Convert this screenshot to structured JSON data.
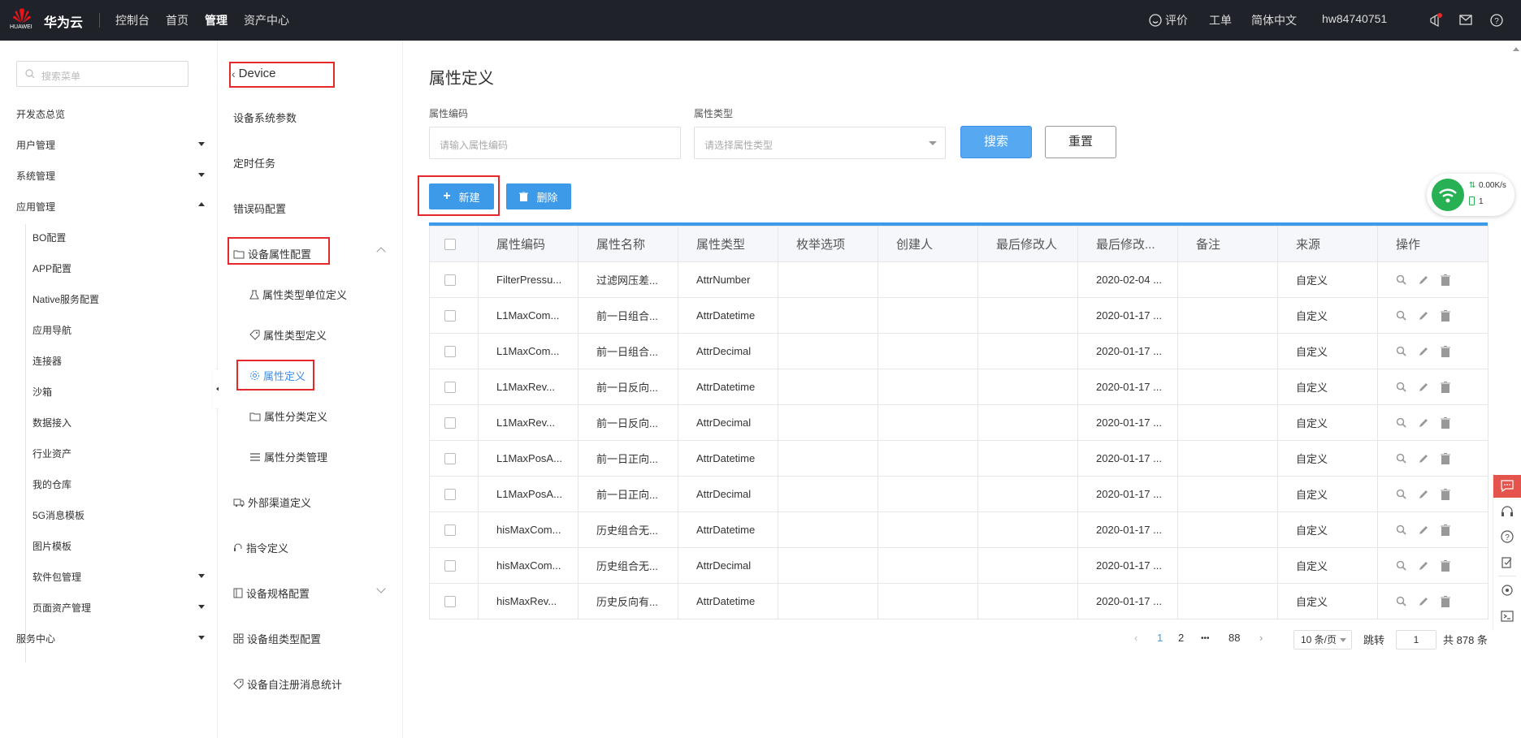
{
  "topbar": {
    "logo_text": "HUAWEI",
    "brand": "华为云",
    "nav": [
      "控制台",
      "首页",
      "管理",
      "资产中心"
    ],
    "active_nav": "管理",
    "right": {
      "feedback": "评价",
      "ticket": "工单",
      "language": "简体中文",
      "username": "hw84740751"
    }
  },
  "sidebar": {
    "search_placeholder": "搜索菜单",
    "items": [
      {
        "label": "开发态总览"
      },
      {
        "label": "用户管理",
        "arrow": "down"
      },
      {
        "label": "系统管理",
        "arrow": "down"
      },
      {
        "label": "应用管理",
        "arrow": "up"
      }
    ],
    "sub_items": [
      "BO配置",
      "APP配置",
      "Native服务配置",
      "应用导航",
      "连接器",
      "沙箱",
      "数据接入",
      "行业资产",
      "我的仓库",
      "5G消息模板",
      "图片模板",
      "软件包管理",
      "页面资产管理"
    ],
    "bottom_items": [
      {
        "label": "服务中心",
        "arrow": "down"
      }
    ]
  },
  "menu2": {
    "back_label": "Device",
    "items": {
      "sys_params": "设备系统参数",
      "timer": "定时任务",
      "error_code": "错误码配置",
      "attr_config": "设备属性配置",
      "attr_unit": "属性类型单位定义",
      "attr_type": "属性类型定义",
      "attr_def": "属性定义",
      "attr_cat_def": "属性分类定义",
      "attr_cat_mgmt": "属性分类管理",
      "ext_channel": "外部渠道定义",
      "cmd_def": "指令定义",
      "spec_config": "设备规格配置",
      "group_type": "设备组类型配置",
      "self_reg": "设备自注册消息统计"
    }
  },
  "main": {
    "title": "属性定义",
    "filters": {
      "code_label": "属性编码",
      "code_placeholder": "请输入属性编码",
      "type_label": "属性类型",
      "type_placeholder": "请选择属性类型"
    },
    "buttons": {
      "search": "搜索",
      "reset": "重置",
      "new": "新建",
      "delete": "删除"
    },
    "table": {
      "columns": [
        "属性编码",
        "属性名称",
        "属性类型",
        "枚举选项",
        "创建人",
        "最后修改人",
        "最后修改...",
        "备注",
        "来源",
        "操作"
      ],
      "rows": [
        {
          "code": "FilterPressu...",
          "name": "过滤网压差...",
          "type": "AttrNumber",
          "enum": "",
          "creator": "",
          "modifier": "",
          "modified": "2020-02-04 ...",
          "remark": "",
          "source": "自定义"
        },
        {
          "code": "L1MaxCom...",
          "name": "前一日组合...",
          "type": "AttrDatetime",
          "enum": "",
          "creator": "",
          "modifier": "",
          "modified": "2020-01-17 ...",
          "remark": "",
          "source": "自定义"
        },
        {
          "code": "L1MaxCom...",
          "name": "前一日组合...",
          "type": "AttrDecimal",
          "enum": "",
          "creator": "",
          "modifier": "",
          "modified": "2020-01-17 ...",
          "remark": "",
          "source": "自定义"
        },
        {
          "code": "L1MaxRev...",
          "name": "前一日反向...",
          "type": "AttrDatetime",
          "enum": "",
          "creator": "",
          "modifier": "",
          "modified": "2020-01-17 ...",
          "remark": "",
          "source": "自定义"
        },
        {
          "code": "L1MaxRev...",
          "name": "前一日反向...",
          "type": "AttrDecimal",
          "enum": "",
          "creator": "",
          "modifier": "",
          "modified": "2020-01-17 ...",
          "remark": "",
          "source": "自定义"
        },
        {
          "code": "L1MaxPosA...",
          "name": "前一日正向...",
          "type": "AttrDatetime",
          "enum": "",
          "creator": "",
          "modifier": "",
          "modified": "2020-01-17 ...",
          "remark": "",
          "source": "自定义"
        },
        {
          "code": "L1MaxPosA...",
          "name": "前一日正向...",
          "type": "AttrDecimal",
          "enum": "",
          "creator": "",
          "modifier": "",
          "modified": "2020-01-17 ...",
          "remark": "",
          "source": "自定义"
        },
        {
          "code": "hisMaxCom...",
          "name": "历史组合无...",
          "type": "AttrDatetime",
          "enum": "",
          "creator": "",
          "modifier": "",
          "modified": "2020-01-17 ...",
          "remark": "",
          "source": "自定义"
        },
        {
          "code": "hisMaxCom...",
          "name": "历史组合无...",
          "type": "AttrDecimal",
          "enum": "",
          "creator": "",
          "modifier": "",
          "modified": "2020-01-17 ...",
          "remark": "",
          "source": "自定义"
        },
        {
          "code": "hisMaxRev...",
          "name": "历史反向有...",
          "type": "AttrDatetime",
          "enum": "",
          "creator": "",
          "modifier": "",
          "modified": "2020-01-17 ...",
          "remark": "",
          "source": "自定义"
        }
      ]
    },
    "pagination": {
      "current": "1",
      "page2": "2",
      "ellipsis": "•••",
      "last": "88",
      "page_size": "10 条/页",
      "jump_label": "跳转",
      "jump_value": "1",
      "total": "共 878 条"
    }
  },
  "net_widget": {
    "speed": "0.00K/s",
    "count": "1"
  },
  "colors": {
    "primary": "#3d9ae8",
    "topbar": "#1f2329",
    "highlight": "#e5282b"
  }
}
